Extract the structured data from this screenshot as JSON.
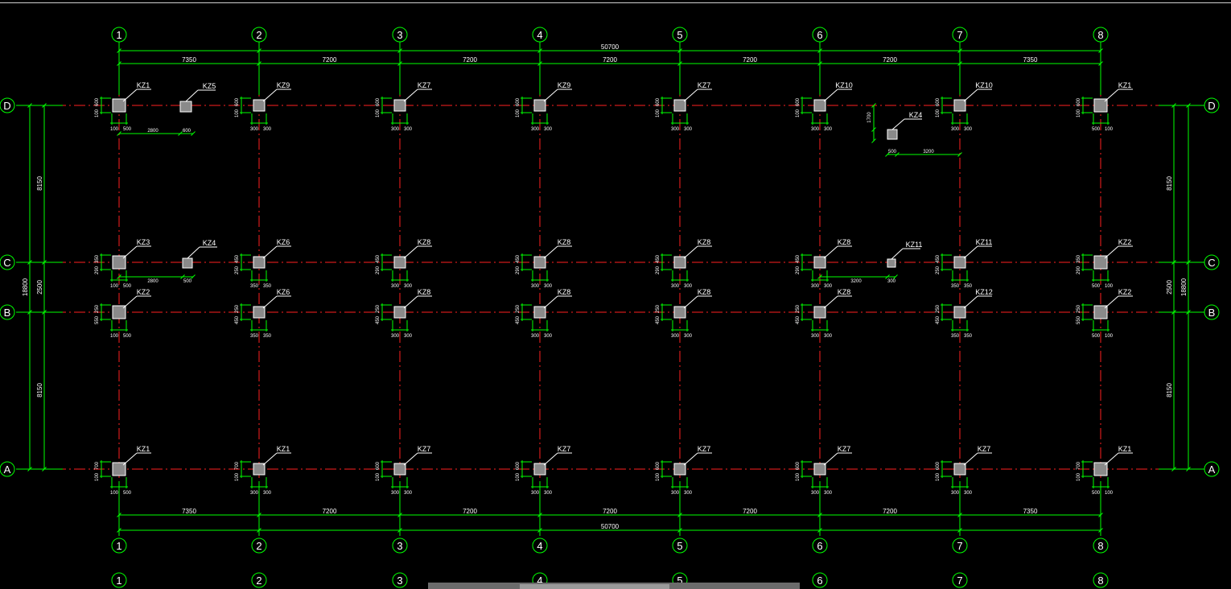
{
  "drawing": {
    "axes_x": [
      "1",
      "2",
      "3",
      "4",
      "5",
      "6",
      "7",
      "8"
    ],
    "axes_y": [
      "D",
      "C",
      "B",
      "A"
    ],
    "overall_length": "50700",
    "bay_spans": [
      "7350",
      "7200",
      "7200",
      "7200",
      "7200",
      "7200",
      "7350"
    ],
    "left_dims": {
      "total": "18800",
      "segments": [
        "8150",
        "2500",
        "8150"
      ]
    },
    "right_dims": {
      "total": "18800",
      "segments": [
        "8150",
        "2500",
        "8150"
      ]
    },
    "columns": {
      "D": [
        "KZ1",
        "KZ9",
        "KZ7",
        "KZ9",
        "KZ7",
        "KZ10",
        "KZ10",
        "KZ1"
      ],
      "C": [
        "KZ3",
        "KZ6",
        "KZ8",
        "KZ8",
        "KZ8",
        "KZ8",
        "KZ11",
        "KZ2"
      ],
      "B": [
        "KZ2",
        "KZ6",
        "KZ8",
        "KZ8",
        "KZ8",
        "KZ8",
        "KZ12",
        "KZ2"
      ],
      "A": [
        "KZ1",
        "KZ1",
        "KZ7",
        "KZ7",
        "KZ7",
        "KZ7",
        "KZ7",
        "KZ1"
      ]
    },
    "extra_columns": [
      {
        "label": "KZ5",
        "dims": [
          "2800",
          "600"
        ]
      },
      {
        "label": "KZ4",
        "dims": [
          "2800",
          "500"
        ]
      },
      {
        "label": "KZ4",
        "dims": [
          "500",
          "3200",
          "1700"
        ]
      },
      {
        "label": "KZ11",
        "dims": [
          "3200",
          "300"
        ]
      }
    ],
    "col_dims": {
      "row_D": {
        "left": [
          "600",
          "100"
        ],
        "bottom": [
          "100",
          "500"
        ]
      },
      "row_D_typ": {
        "left": [
          "600",
          "100"
        ],
        "bottom": [
          "300",
          "300"
        ]
      },
      "row_C": {
        "left": [
          "350",
          "290"
        ],
        "bottom": [
          "100",
          "500"
        ]
      },
      "row_C_typ": {
        "left": [
          "450",
          "290"
        ],
        "bottom": [
          "300",
          "300"
        ]
      },
      "row_C_2": {
        "left": [
          "450",
          "250"
        ],
        "bottom": [
          "350",
          "350"
        ]
      },
      "row_B": {
        "left": [
          "250",
          "550"
        ],
        "bottom": [
          "100",
          "500"
        ]
      },
      "row_B_typ": {
        "left": [
          "250",
          "450"
        ],
        "bottom": [
          "300",
          "300"
        ]
      },
      "row_B_2": {
        "left": [
          "250",
          "450"
        ],
        "bottom": [
          "350",
          "350"
        ]
      },
      "row_A": {
        "left": [
          "700",
          "100"
        ],
        "bottom": [
          "100",
          "500"
        ]
      },
      "row_A_typ": {
        "left": [
          "600",
          "100"
        ],
        "bottom": [
          "300",
          "300"
        ]
      },
      "row_A_2": {
        "left": [
          "700",
          "100"
        ],
        "bottom": [
          "300",
          "300"
        ]
      },
      "right_col_bottom": [
        "500",
        "100"
      ],
      "kz7_row_c_bottom": [
        "350",
        "350"
      ]
    },
    "colors": {
      "grid": "#00ff00",
      "axis_line": "#ff2020",
      "column_fill": "#8a8a8a",
      "text": "#ffffff"
    }
  }
}
